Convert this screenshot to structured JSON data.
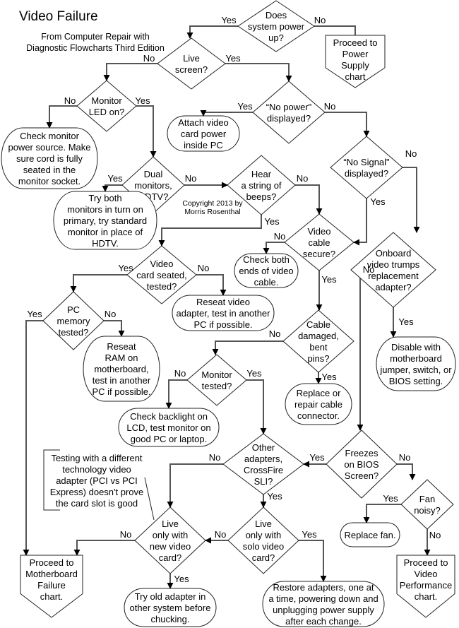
{
  "title": "Video Failure",
  "subtitle": [
    "From Computer Repair with",
    "Diagnostic Flowcharts Third Edition"
  ],
  "copyright": [
    "Copyright 2013 by",
    "Morris Rosenthal"
  ],
  "labels": {
    "yes": "Yes",
    "no": "No"
  },
  "nodes": {
    "power_up": {
      "type": "decision",
      "lines": [
        "Does",
        "system power",
        "up?"
      ]
    },
    "power_supply": {
      "type": "offpage",
      "lines": [
        "Proceed to",
        "Power",
        "Supply",
        "chart"
      ]
    },
    "live_screen": {
      "type": "decision",
      "lines": [
        "Live",
        "screen?"
      ]
    },
    "monitor_led": {
      "type": "decision",
      "lines": [
        "Monitor",
        "LED on?"
      ]
    },
    "check_monitor_power": {
      "type": "terminal",
      "lines": [
        "Check monitor",
        "power source. Make",
        "sure cord is fully",
        "seated in the",
        "monitor socket."
      ]
    },
    "no_power_displayed": {
      "type": "decision",
      "lines": [
        "“No power\"",
        "displayed?"
      ]
    },
    "attach_power": {
      "type": "terminal",
      "lines": [
        "Attach video",
        "card power",
        "inside PC"
      ]
    },
    "no_signal": {
      "type": "decision",
      "lines": [
        "“No Signal\"",
        "displayed?"
      ]
    },
    "dual_monitors": {
      "type": "decision",
      "lines": [
        "Dual",
        "monitors,",
        "HDTV?"
      ]
    },
    "try_both": {
      "type": "terminal",
      "lines": [
        "Try both",
        "monitors in turn on",
        "primary, try standard",
        "monitor in place of",
        "HDTV."
      ]
    },
    "hear_beeps": {
      "type": "decision",
      "lines": [
        "Hear",
        "a string of",
        "beeps?"
      ]
    },
    "cable_secure": {
      "type": "decision",
      "lines": [
        "Video",
        "cable",
        "secure?"
      ]
    },
    "check_cable_ends": {
      "type": "terminal",
      "lines": [
        "Check both",
        "ends of video",
        "cable."
      ]
    },
    "onboard_trumps": {
      "type": "decision",
      "lines": [
        "Onboard",
        "video trumps",
        "replacement",
        "adapter?"
      ]
    },
    "card_seated": {
      "type": "decision",
      "lines": [
        "Video",
        "card  seated,",
        "tested?"
      ]
    },
    "reseat_video": {
      "type": "terminal",
      "lines": [
        "Reseat video",
        "adapter, test in another",
        "PC if possible."
      ]
    },
    "pc_memory": {
      "type": "decision",
      "lines": [
        "PC",
        "memory",
        "tested?"
      ]
    },
    "reseat_ram": {
      "type": "terminal",
      "lines": [
        "Reseat",
        "RAM on",
        "motherboard,",
        "test in another",
        "PC if possible."
      ]
    },
    "cable_damaged": {
      "type": "decision",
      "lines": [
        "Cable",
        "damaged,",
        "bent",
        "pins?"
      ]
    },
    "replace_cable": {
      "type": "terminal",
      "lines": [
        "Replace or",
        "repair cable",
        "connector."
      ]
    },
    "disable_onboard": {
      "type": "terminal",
      "lines": [
        "Disable with",
        "motherboard",
        "jumper, switch, or",
        "BIOS setting."
      ]
    },
    "monitor_tested": {
      "type": "decision",
      "lines": [
        "Monitor",
        "tested?"
      ]
    },
    "check_backlight": {
      "type": "terminal",
      "lines": [
        "Check backlight on",
        "LCD, test monitor on",
        "good PC or laptop."
      ]
    },
    "other_adapters": {
      "type": "decision",
      "lines": [
        "Other",
        "adapters,",
        "CrossFire",
        "SLI?"
      ]
    },
    "freezes_bios": {
      "type": "decision",
      "lines": [
        "Freezes",
        "on BIOS",
        "Screen?"
      ]
    },
    "fan_noisy": {
      "type": "decision",
      "lines": [
        "Fan",
        "noisy?"
      ]
    },
    "replace_fan": {
      "type": "terminal",
      "lines": [
        "Replace fan."
      ]
    },
    "live_new_card": {
      "type": "decision",
      "lines": [
        "Live",
        "only with",
        "new video",
        "card?"
      ]
    },
    "live_solo_card": {
      "type": "decision",
      "lines": [
        "Live",
        "only with",
        "solo video",
        "card?"
      ]
    },
    "motherboard_chart": {
      "type": "offpage",
      "lines": [
        "Proceed to",
        "Motherboard",
        "Failure",
        "chart."
      ]
    },
    "try_old_adapter": {
      "type": "terminal",
      "lines": [
        "Try old adapter in",
        "other system before",
        "chucking."
      ]
    },
    "restore_adapters": {
      "type": "terminal",
      "lines": [
        "Restore adapters, one at",
        "a time, powering down and",
        "unplugging power supply",
        "after each change."
      ]
    },
    "video_performance": {
      "type": "offpage",
      "lines": [
        "Proceed to",
        "Video",
        "Performance",
        "chart."
      ]
    }
  },
  "annotation": [
    "Testing with a different",
    "technology video",
    "adapter  (PCI vs PCI",
    "Express) doesn't prove",
    "the card slot is good"
  ],
  "edges": [
    {
      "from": "power_up",
      "to": "live_screen",
      "label": "yes"
    },
    {
      "from": "power_up",
      "to": "power_supply",
      "label": "no"
    },
    {
      "from": "live_screen",
      "to": "monitor_led",
      "label": "no"
    },
    {
      "from": "live_screen",
      "to": "no_power_displayed",
      "label": "yes"
    },
    {
      "from": "monitor_led",
      "to": "check_monitor_power",
      "label": "no"
    },
    {
      "from": "monitor_led",
      "to": "dual_monitors",
      "label": "yes"
    },
    {
      "from": "no_power_displayed",
      "to": "attach_power",
      "label": "yes"
    },
    {
      "from": "no_power_displayed",
      "to": "no_signal",
      "label": "no"
    },
    {
      "from": "no_signal",
      "to": "cable_secure",
      "label": "yes"
    },
    {
      "from": "no_signal",
      "to": "onboard_trumps",
      "label": "no"
    },
    {
      "from": "dual_monitors",
      "to": "try_both",
      "label": "yes"
    },
    {
      "from": "dual_monitors",
      "to": "hear_beeps",
      "label": "no"
    },
    {
      "from": "hear_beeps",
      "to": "card_seated",
      "label": "yes"
    },
    {
      "from": "hear_beeps",
      "to": "cable_secure",
      "label": "no"
    },
    {
      "from": "cable_secure",
      "to": "check_cable_ends",
      "label": "no"
    },
    {
      "from": "cable_secure",
      "to": "cable_damaged",
      "label": "yes"
    },
    {
      "from": "onboard_trumps",
      "to": "freezes_bios",
      "label": "no"
    },
    {
      "from": "onboard_trumps",
      "to": "disable_onboard",
      "label": "yes"
    },
    {
      "from": "card_seated",
      "to": "pc_memory",
      "label": "yes"
    },
    {
      "from": "card_seated",
      "to": "reseat_video",
      "label": "no"
    },
    {
      "from": "pc_memory",
      "to": "motherboard_chart",
      "label": "yes"
    },
    {
      "from": "pc_memory",
      "to": "reseat_ram",
      "label": "no"
    },
    {
      "from": "cable_damaged",
      "to": "monitor_tested",
      "label": "no"
    },
    {
      "from": "cable_damaged",
      "to": "replace_cable",
      "label": "yes"
    },
    {
      "from": "monitor_tested",
      "to": "check_backlight",
      "label": "no"
    },
    {
      "from": "monitor_tested",
      "to": "other_adapters",
      "label": "yes"
    },
    {
      "from": "freezes_bios",
      "to": "other_adapters",
      "label": "yes"
    },
    {
      "from": "freezes_bios",
      "to": "fan_noisy",
      "label": "no"
    },
    {
      "from": "fan_noisy",
      "to": "replace_fan",
      "label": "yes"
    },
    {
      "from": "fan_noisy",
      "to": "video_performance",
      "label": "no"
    },
    {
      "from": "other_adapters",
      "to": "live_new_card",
      "label": "no"
    },
    {
      "from": "other_adapters",
      "to": "live_solo_card",
      "label": "yes"
    },
    {
      "from": "live_solo_card",
      "to": "live_new_card",
      "label": "no"
    },
    {
      "from": "live_solo_card",
      "to": "restore_adapters",
      "label": "yes"
    },
    {
      "from": "live_new_card",
      "to": "motherboard_chart",
      "label": "no"
    },
    {
      "from": "live_new_card",
      "to": "try_old_adapter",
      "label": "yes"
    }
  ]
}
